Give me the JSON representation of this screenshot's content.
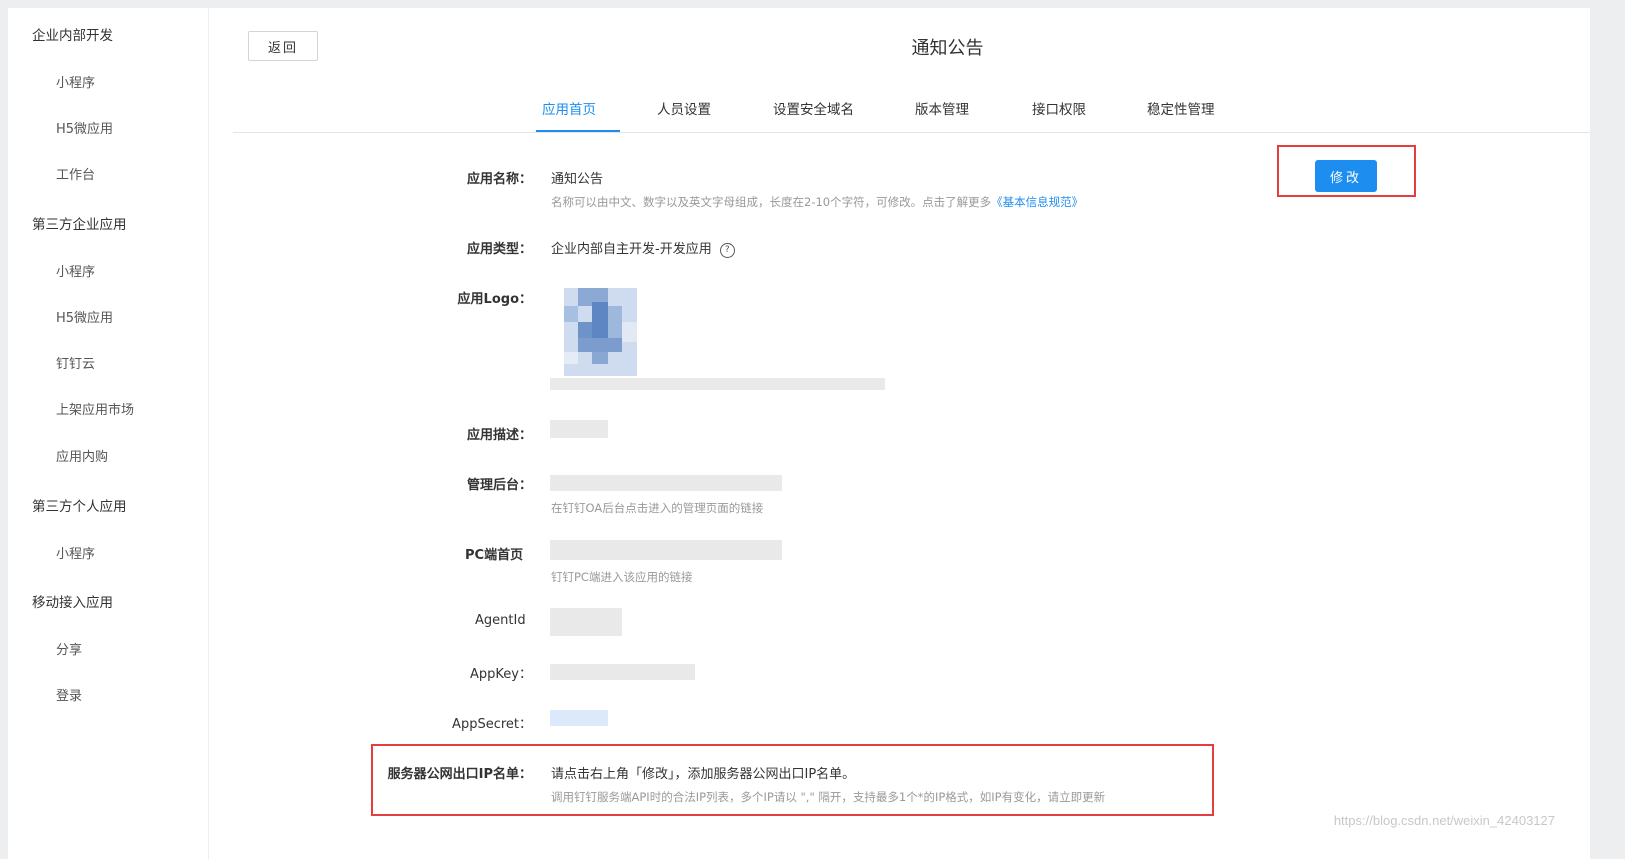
{
  "sidebar": {
    "groups": [
      {
        "label": "企业内部开发",
        "items": [
          "小程序",
          "H5微应用",
          "工作台"
        ]
      },
      {
        "label": "第三方企业应用",
        "items": [
          "小程序",
          "H5微应用",
          "钉钉云",
          "上架应用市场",
          "应用内购"
        ]
      },
      {
        "label": "第三方个人应用",
        "items": [
          "小程序"
        ]
      },
      {
        "label": "移动接入应用",
        "items": [
          "分享",
          "登录"
        ]
      }
    ]
  },
  "header": {
    "back_label": "返回",
    "title": "通知公告"
  },
  "tabs": [
    {
      "label": "应用首页",
      "active": true
    },
    {
      "label": "人员设置",
      "active": false
    },
    {
      "label": "设置安全域名",
      "active": false
    },
    {
      "label": "版本管理",
      "active": false
    },
    {
      "label": "接口权限",
      "active": false
    },
    {
      "label": "稳定性管理",
      "active": false
    }
  ],
  "edit_button": "修改",
  "fields": {
    "app_name": {
      "label": "应用名称：",
      "value": "通知公告",
      "hint": "名称可以由中文、数字以及英文字母组成，长度在2-10个字符，可修改。点击了解更多",
      "hint_link": "《基本信息规范》"
    },
    "app_type": {
      "label": "应用类型：",
      "value": "企业内部自主开发-开发应用"
    },
    "app_logo": {
      "label": "应用Logo："
    },
    "app_desc": {
      "label": "应用描述："
    },
    "admin": {
      "label": "管理后台：",
      "hint": "在钉钉OA后台点击进入的管理页面的链接"
    },
    "pc_home": {
      "label": "PC端首页",
      "hint": "钉钉PC端进入该应用的链接"
    },
    "agent_id": {
      "label": "AgentId"
    },
    "app_key": {
      "label": "AppKey："
    },
    "app_secret": {
      "label": "AppSecret："
    },
    "ip_whitelist": {
      "label": "服务器公网出口IP名单：",
      "value": "请点击右上角「修改」，添加服务器公网出口IP名单。",
      "hint": "调用钉钉服务端API时的合法IP列表，多个IP请以 \",\" 隔开，支持最多1个*的IP格式，如IP有变化，请立即更新"
    }
  },
  "watermark": "https://blog.csdn.net/weixin_42403127",
  "colors": {
    "accent": "#1d8ef0",
    "highlight_border": "#e53e3e"
  }
}
